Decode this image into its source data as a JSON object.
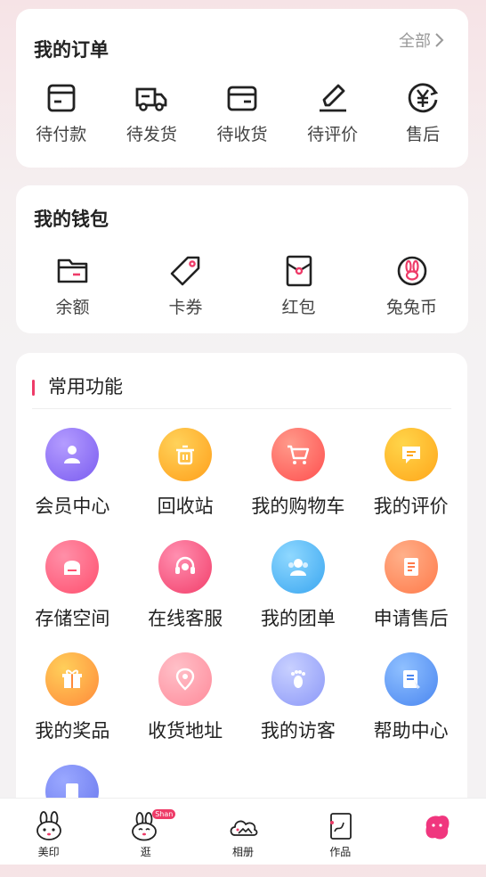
{
  "orders": {
    "title": "我的订单",
    "all_label": "全部",
    "items": [
      {
        "label": "待付款",
        "icon": "wallet-icon"
      },
      {
        "label": "待发货",
        "icon": "truck-icon"
      },
      {
        "label": "待收货",
        "icon": "package-icon"
      },
      {
        "label": "待评价",
        "icon": "pencil-icon"
      },
      {
        "label": "售后",
        "icon": "yen-refund-icon"
      }
    ]
  },
  "wallet": {
    "title": "我的钱包",
    "items": [
      {
        "label": "余额",
        "icon": "folder-icon"
      },
      {
        "label": "卡券",
        "icon": "tag-icon"
      },
      {
        "label": "红包",
        "icon": "red-envelope-icon"
      },
      {
        "label": "兔兔币",
        "icon": "rabbit-coin-icon"
      }
    ]
  },
  "features": {
    "title": "常用功能",
    "accent": "#ee3b68",
    "items": [
      {
        "label": "会员中心",
        "icon": "member-icon",
        "c1": "#b49cff",
        "c2": "#7a5cf0"
      },
      {
        "label": "回收站",
        "icon": "trash-icon",
        "c1": "#ffd25a",
        "c2": "#ff9f1a"
      },
      {
        "label": "我的购物车",
        "icon": "cart-icon",
        "c1": "#ff9a8a",
        "c2": "#ff4f4f"
      },
      {
        "label": "我的评价",
        "icon": "comment-icon",
        "c1": "#ffd54a",
        "c2": "#ffa61a"
      },
      {
        "label": "存储空间",
        "icon": "storage-icon",
        "c1": "#ff8fa8",
        "c2": "#ff4f6e"
      },
      {
        "label": "在线客服",
        "icon": "headset-icon",
        "c1": "#ff8fb0",
        "c2": "#f23e6a"
      },
      {
        "label": "我的团单",
        "icon": "group-icon",
        "c1": "#8fd8ff",
        "c2": "#3aa6f0"
      },
      {
        "label": "申请售后",
        "icon": "document-icon",
        "c1": "#ffb08a",
        "c2": "#ff7a4a"
      },
      {
        "label": "我的奖品",
        "icon": "gift-icon",
        "c1": "#ffcf5a",
        "c2": "#ff8a3a"
      },
      {
        "label": "收货地址",
        "icon": "location-icon",
        "c1": "#ffc0c8",
        "c2": "#ff8a9a"
      },
      {
        "label": "我的访客",
        "icon": "footprint-icon",
        "c1": "#c8d0ff",
        "c2": "#8c98f8"
      },
      {
        "label": "帮助中心",
        "icon": "help-doc-icon",
        "c1": "#8fc0ff",
        "c2": "#4a86f0"
      },
      {
        "label": "",
        "icon": "extra-doc-icon",
        "c1": "#9aa8ff",
        "c2": "#6a78ee"
      }
    ]
  },
  "tabbar": {
    "tabs": [
      {
        "label": "美印",
        "icon": "rabbit-head-icon"
      },
      {
        "label": "逛",
        "icon": "rabbit-shop-icon",
        "badge": "Shan"
      },
      {
        "label": "相册",
        "icon": "cloud-album-icon"
      },
      {
        "label": "作品",
        "icon": "artwork-icon"
      },
      {
        "label": "",
        "icon": "profile-avatar-icon"
      }
    ]
  }
}
